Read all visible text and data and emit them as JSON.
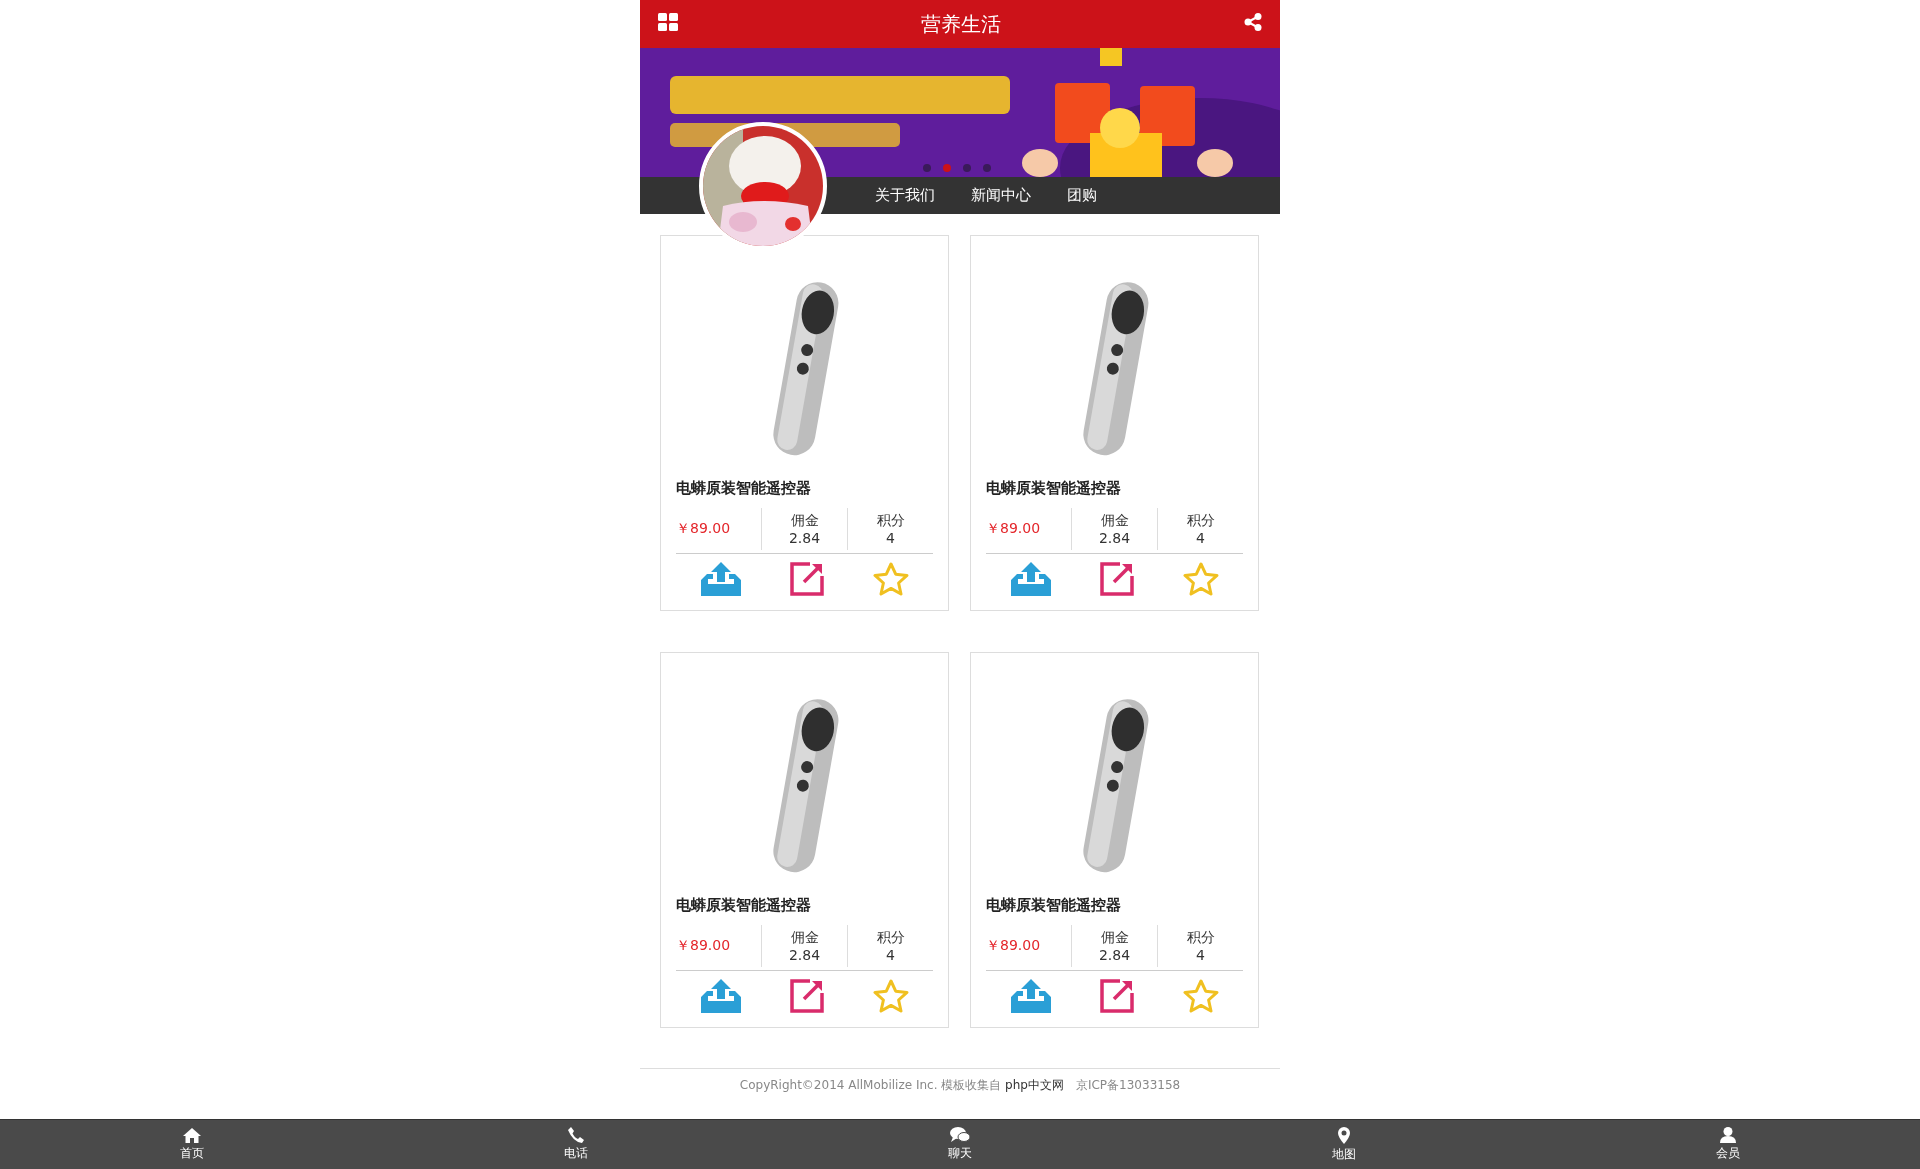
{
  "header": {
    "title": "营养生活"
  },
  "banner": {
    "kind": "picture",
    "dots": [
      {
        "selected": false
      },
      {
        "selected": true
      },
      {
        "selected": false
      },
      {
        "selected": false
      }
    ]
  },
  "nav": {
    "items": [
      "关于我们",
      "新闻中心",
      "团购"
    ]
  },
  "products": [
    {
      "name": "电蟒原装智能遥控器",
      "price": "￥89.00",
      "commission_label": "佣金",
      "commission": "2.84",
      "points_label": "积分",
      "points": "4"
    },
    {
      "name": "电蟒原装智能遥控器",
      "price": "￥89.00",
      "commission_label": "佣金",
      "commission": "2.84",
      "points_label": "积分",
      "points": "4"
    },
    {
      "name": "电蟒原装智能遥控器",
      "price": "￥89.00",
      "commission_label": "佣金",
      "commission": "2.84",
      "points_label": "积分",
      "points": "4"
    },
    {
      "name": "电蟒原装智能遥控器",
      "price": "￥89.00",
      "commission_label": "佣金",
      "commission": "2.84",
      "points_label": "积分",
      "points": "4"
    }
  ],
  "footer": {
    "copyright": "CopyRight©2014 AllMobilize Inc. 模板收集自",
    "link": "php中文网",
    "icp": "京ICP备13033158"
  },
  "tabbar": [
    {
      "kind": "home",
      "label": "首页"
    },
    {
      "kind": "phone",
      "label": "电话"
    },
    {
      "kind": "chat",
      "label": "聊天"
    },
    {
      "kind": "pin",
      "label": "地图"
    },
    {
      "kind": "user",
      "label": "会员"
    }
  ]
}
